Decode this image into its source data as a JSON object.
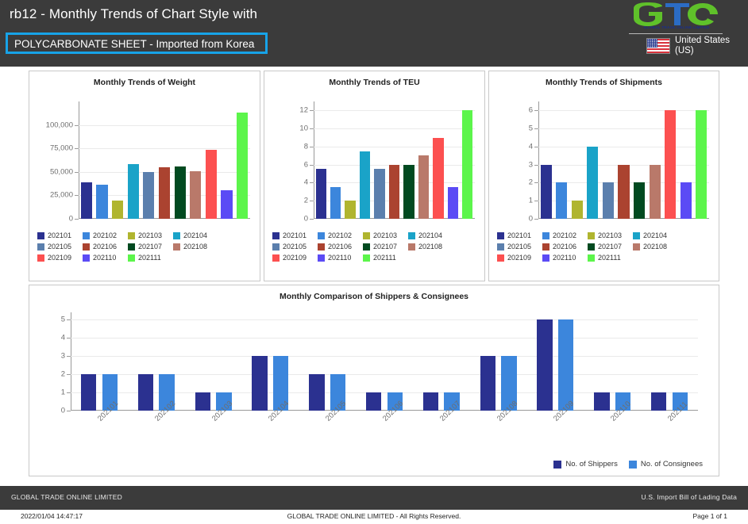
{
  "header": {
    "title": "rb12 - Monthly Trends of Chart Style with",
    "subtitle": "POLYCARBONATE SHEET - Imported from Korea",
    "logo_caption": "GLOBAL TRADE ONLINE LIMITED",
    "country_line1": "United States",
    "country_line2": "(US)",
    "accent_color": "#17a3e8",
    "bar_color": "#3b3b3b"
  },
  "months": [
    "202101",
    "202102",
    "202103",
    "202104",
    "202105",
    "202106",
    "202107",
    "202108",
    "202109",
    "202110",
    "202111"
  ],
  "month_colors": [
    "#2b3190",
    "#3c86dc",
    "#b0b52f",
    "#1aa3c8",
    "#5b7fad",
    "#ab4330",
    "#014a20",
    "#b9796a",
    "#fc5050",
    "#5b4bf5",
    "#5cf54b"
  ],
  "panels": [
    {
      "name": "weight",
      "title": "Monthly Trends of Weight",
      "chart_data": {
        "type": "bar",
        "title": "Monthly Trends of Weight",
        "categories": [
          "202101",
          "202102",
          "202103",
          "202104",
          "202105",
          "202106",
          "202107",
          "202108",
          "202109",
          "202110",
          "202111"
        ],
        "values": [
          39000,
          36500,
          19500,
          58000,
          49500,
          54500,
          55500,
          50500,
          73500,
          30500,
          113000
        ],
        "ylabel": "",
        "xlabel": "",
        "ylim": [
          0,
          125000
        ],
        "yticks": [
          0,
          25000,
          50000,
          75000,
          100000
        ],
        "ytick_labels": [
          "0",
          "25,000",
          "50,000",
          "75,000",
          "100,000"
        ],
        "grid": true,
        "legend_position": "bottom"
      }
    },
    {
      "name": "teu",
      "title": "Monthly Trends of TEU",
      "chart_data": {
        "type": "bar",
        "title": "Monthly Trends of TEU",
        "categories": [
          "202101",
          "202102",
          "202103",
          "202104",
          "202105",
          "202106",
          "202107",
          "202108",
          "202109",
          "202110",
          "202111"
        ],
        "values": [
          5.5,
          3.5,
          2,
          7.5,
          5.5,
          6,
          6,
          7,
          9,
          3.5,
          12
        ],
        "ylabel": "",
        "xlabel": "",
        "ylim": [
          0,
          13
        ],
        "yticks": [
          0,
          2,
          4,
          6,
          8,
          10,
          12
        ],
        "ytick_labels": [
          "0",
          "2",
          "4",
          "6",
          "8",
          "10",
          "12"
        ],
        "grid": true,
        "legend_position": "bottom"
      }
    },
    {
      "name": "shipments",
      "title": "Monthly Trends of Shipments",
      "chart_data": {
        "type": "bar",
        "title": "Monthly Trends of Shipments",
        "categories": [
          "202101",
          "202102",
          "202103",
          "202104",
          "202105",
          "202106",
          "202107",
          "202108",
          "202109",
          "202110",
          "202111"
        ],
        "values": [
          3,
          2,
          1,
          4,
          2,
          3,
          2,
          3,
          6,
          2,
          6
        ],
        "ylabel": "",
        "xlabel": "",
        "ylim": [
          0,
          6.5
        ],
        "yticks": [
          0,
          1,
          2,
          3,
          4,
          5,
          6
        ],
        "ytick_labels": [
          "0",
          "1",
          "2",
          "3",
          "4",
          "5",
          "6"
        ],
        "grid": true,
        "legend_position": "bottom"
      }
    }
  ],
  "bottom_panel": {
    "title": "Monthly Comparison of Shippers & Consignees",
    "legend": [
      {
        "label": "No. of Shippers",
        "color": "#2b3190"
      },
      {
        "label": "No. of Consignees",
        "color": "#3c86dc"
      }
    ],
    "chart_data": {
      "type": "bar",
      "title": "Monthly Comparison of Shippers & Consignees",
      "categories": [
        "202101",
        "202102",
        "202103",
        "202104",
        "202105",
        "202106",
        "202107",
        "202108",
        "202109",
        "202110",
        "202111"
      ],
      "series": [
        {
          "name": "No. of Shippers",
          "color": "#2b3190",
          "values": [
            2,
            2,
            1,
            3,
            2,
            1,
            1,
            3,
            5,
            1,
            1
          ]
        },
        {
          "name": "No. of Consignees",
          "color": "#3c86dc",
          "values": [
            2,
            2,
            1,
            3,
            2,
            1,
            1,
            3,
            5,
            1,
            1
          ]
        }
      ],
      "ylabel": "",
      "xlabel": "",
      "ylim": [
        0,
        5.4
      ],
      "yticks": [
        0,
        1,
        2,
        3,
        4,
        5
      ],
      "ytick_labels": [
        "0",
        "1",
        "2",
        "3",
        "4",
        "5"
      ],
      "grid": true,
      "legend_position": "bottom-right"
    }
  },
  "footer": {
    "company": "GLOBAL TRADE ONLINE LIMITED",
    "dataset": "U.S. Import Bill of Lading Data",
    "timestamp": "2022/01/04 14:47:17",
    "copyright": "GLOBAL TRADE ONLINE LIMITED - All Rights Reserved.",
    "page": "Page 1 of 1"
  }
}
